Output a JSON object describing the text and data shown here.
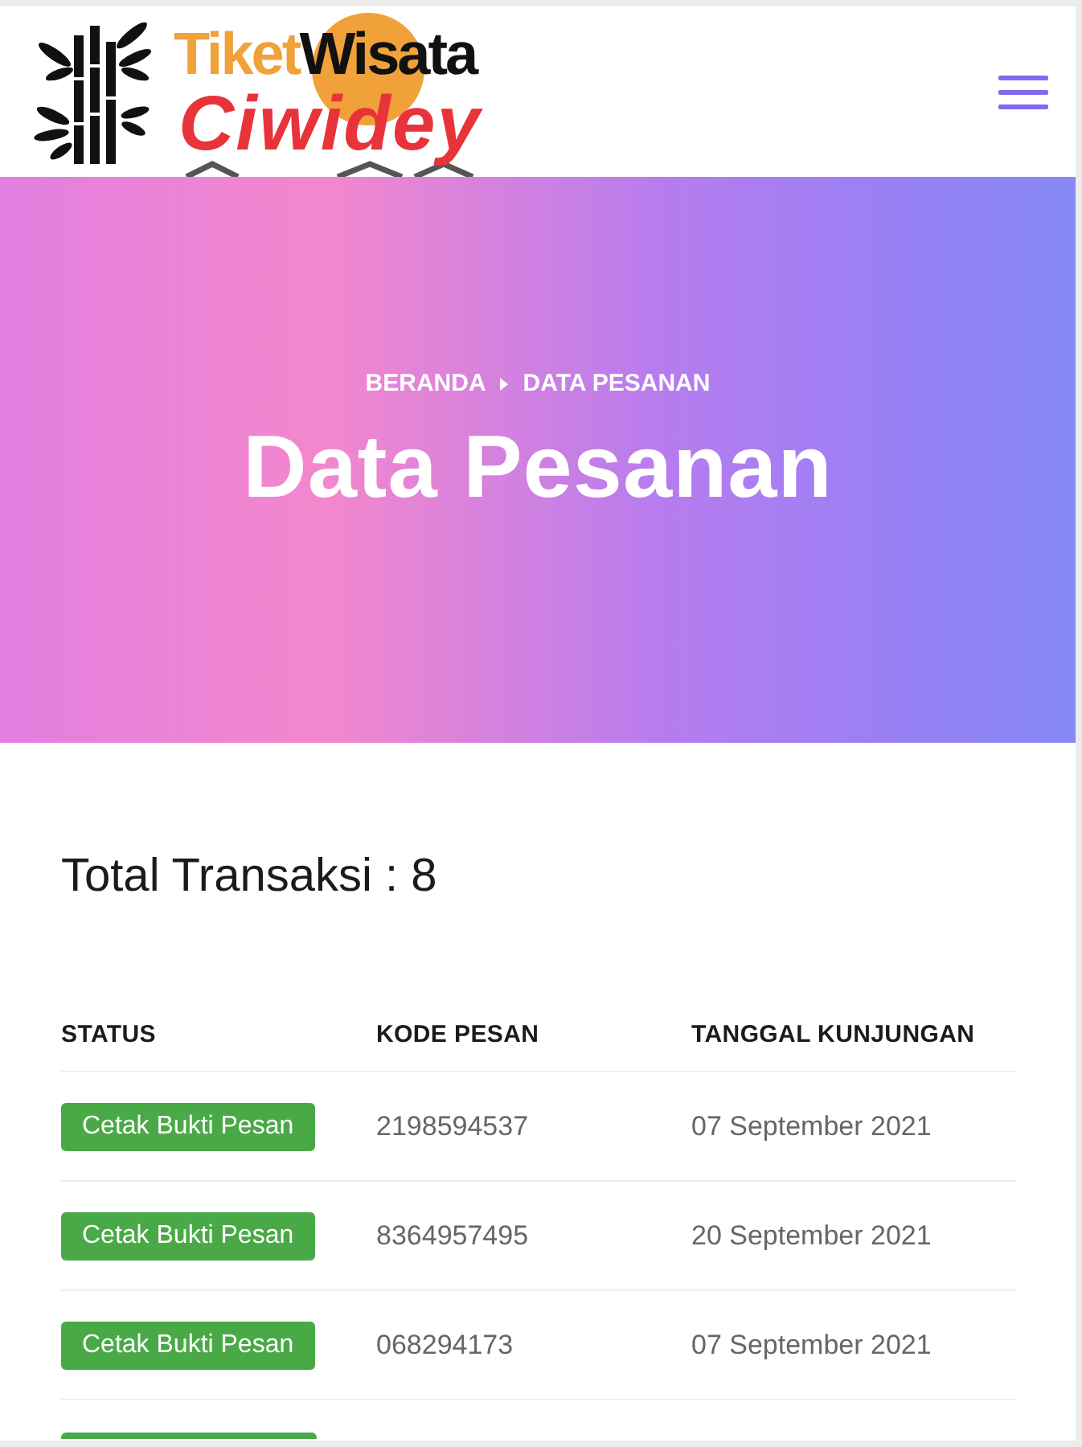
{
  "logo": {
    "words": [
      "Tiket",
      "Wisata"
    ],
    "subtitle": "Ciwidey"
  },
  "hero": {
    "breadcrumb": [
      {
        "label": "BERANDA"
      },
      {
        "label": "DATA PESANAN"
      }
    ],
    "title": "Data Pesanan"
  },
  "summary": {
    "label": "Total Transaksi : 8"
  },
  "table": {
    "columns": [
      "STATUS",
      "KODE PESAN",
      "TANGGAL KUNJUNGAN"
    ],
    "rows": [
      {
        "status": "Cetak Bukti Pesan",
        "code": "2198594537",
        "date": "07 September 2021"
      },
      {
        "status": "Cetak Bukti Pesan",
        "code": "8364957495",
        "date": "20 September 2021"
      },
      {
        "status": "Cetak Bukti Pesan",
        "code": "068294173",
        "date": "07 September 2021"
      }
    ],
    "more_rows_below": true
  }
}
